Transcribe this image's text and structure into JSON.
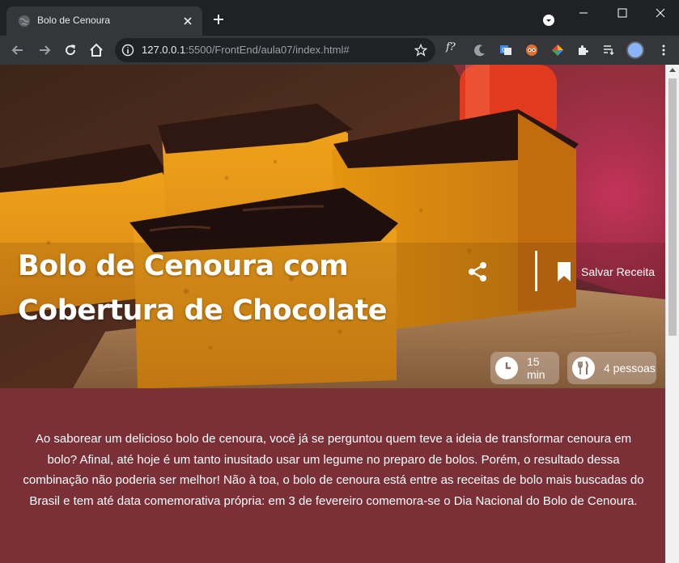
{
  "browser": {
    "tab_title": "Bolo de Cenoura",
    "url_host": "127.0.0.1",
    "url_rest": ":5500/FrontEnd/aula07/index.html#",
    "ext_f_label": "f?"
  },
  "hero": {
    "title": "Bolo de Cenoura com Cobertura de Chocolate",
    "save_label": "Salvar Receita",
    "time_label": "15 min",
    "servings_label": "4 pessoas"
  },
  "intro": {
    "text": "Ao saborear um delicioso bolo de cenoura, você já se perguntou quem teve a ideia de transformar cenoura em bolo? Afinal, até hoje é um tanto inusitado usar um legume no preparo de bolos. Porém, o resultado dessa combinação não poderia ser melhor! Não à toa, o bolo de cenoura está entre as receitas de bolo mais buscadas do Brasil e tem até data comemorativa própria: em 3 de fevereiro comemora-se o Dia Nacional do Bolo de Cenoura."
  },
  "colors": {
    "page_background": "#7b2f37",
    "chrome_dark": "#202124",
    "chrome_toolbar": "#35363a"
  },
  "icons": [
    "globe-icon",
    "close-icon",
    "plus-icon",
    "back-icon",
    "forward-icon",
    "reload-icon",
    "home-icon",
    "info-icon",
    "star-icon",
    "share-icon",
    "bookmark-icon",
    "clock-icon",
    "cutlery-icon",
    "puzzle-icon",
    "menu-dots-icon"
  ]
}
